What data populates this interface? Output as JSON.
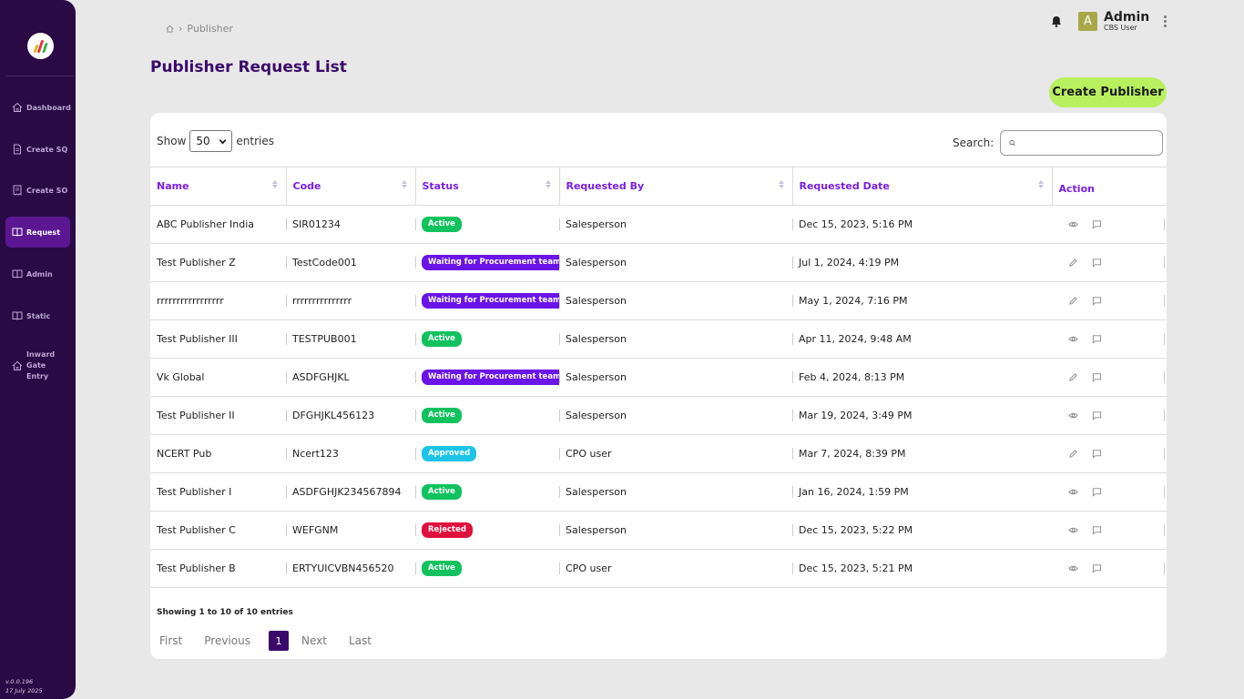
{
  "sidebar": {
    "items": [
      {
        "label": "Dashboard",
        "icon": "home-icon"
      },
      {
        "label": "Create SQ",
        "icon": "document-icon"
      },
      {
        "label": "Create SO",
        "icon": "receipt-icon"
      },
      {
        "label": "Request",
        "icon": "book-icon",
        "active": true
      },
      {
        "label": "Admin",
        "icon": "book-icon"
      },
      {
        "label": "Static",
        "icon": "book-icon"
      },
      {
        "label": "Inward Gate Entry",
        "icon": "home-icon"
      }
    ],
    "version": "v.0.0.196",
    "date": "17 July 2025"
  },
  "header": {
    "breadcrumb": "Publisher",
    "user_initial": "A",
    "user_name": "Admin",
    "user_role": "CBS User"
  },
  "page": {
    "title": "Publisher Request List",
    "create_button": "Create Publisher"
  },
  "table_controls": {
    "show_label": "Show",
    "entries_value": "50",
    "entries_label": "entries",
    "search_label": "Search:",
    "search_value": ""
  },
  "table": {
    "columns": [
      "Name",
      "Code",
      "Status",
      "Requested By",
      "Requested Date",
      "Action"
    ],
    "rows": [
      {
        "name": "ABC Publisher India",
        "code": "SIR01234",
        "status": "Active",
        "requested_by": "Salesperson",
        "date": "Dec 15, 2023, 5:16 PM",
        "action": "view"
      },
      {
        "name": "Test Publisher Z",
        "code": "TestCode001",
        "status": "Waiting for Procurement team",
        "requested_by": "Salesperson",
        "date": "Jul 1, 2024, 4:19 PM",
        "action": "edit"
      },
      {
        "name": "rrrrrrrrrrrrrrrrr",
        "code": "rrrrrrrrrrrrrrr",
        "status": "Waiting for Procurement team",
        "requested_by": "Salesperson",
        "date": "May 1, 2024, 7:16 PM",
        "action": "edit"
      },
      {
        "name": "Test Publisher III",
        "code": "TESTPUB001",
        "status": "Active",
        "requested_by": "Salesperson",
        "date": "Apr 11, 2024, 9:48 AM",
        "action": "view"
      },
      {
        "name": "Vk Global",
        "code": "ASDFGHJKL",
        "status": "Waiting for Procurement team",
        "requested_by": "Salesperson",
        "date": "Feb 4, 2024, 8:13 PM",
        "action": "edit"
      },
      {
        "name": "Test Publisher II",
        "code": "DFGHJKL456123",
        "status": "Active",
        "requested_by": "Salesperson",
        "date": "Mar 19, 2024, 3:49 PM",
        "action": "view"
      },
      {
        "name": "NCERT Pub",
        "code": "Ncert123",
        "status": "Approved",
        "requested_by": "CPO user",
        "date": "Mar 7, 2024, 8:39 PM",
        "action": "edit"
      },
      {
        "name": "Test Publisher I",
        "code": "ASDFGHJK234567894",
        "status": "Active",
        "requested_by": "Salesperson",
        "date": "Jan 16, 2024, 1:59 PM",
        "action": "view"
      },
      {
        "name": "Test Publisher C",
        "code": "WEFGNM",
        "status": "Rejected",
        "requested_by": "Salesperson",
        "date": "Dec 15, 2023, 5:22 PM",
        "action": "view"
      },
      {
        "name": "Test Publisher B",
        "code": "ERTYUICVBN456520",
        "status": "Active",
        "requested_by": "CPO user",
        "date": "Dec 15, 2023, 5:21 PM",
        "action": "view"
      }
    ]
  },
  "status_colors": {
    "Active": "#12c25f",
    "Waiting for Procurement team": "#6a14e8",
    "Approved": "#1cc4e8",
    "Rejected": "#e0103c"
  },
  "footer": {
    "info": "Showing 1 to 10 of 10 entries",
    "first": "First",
    "previous": "Previous",
    "current_page": "1",
    "next": "Next",
    "last": "Last"
  }
}
